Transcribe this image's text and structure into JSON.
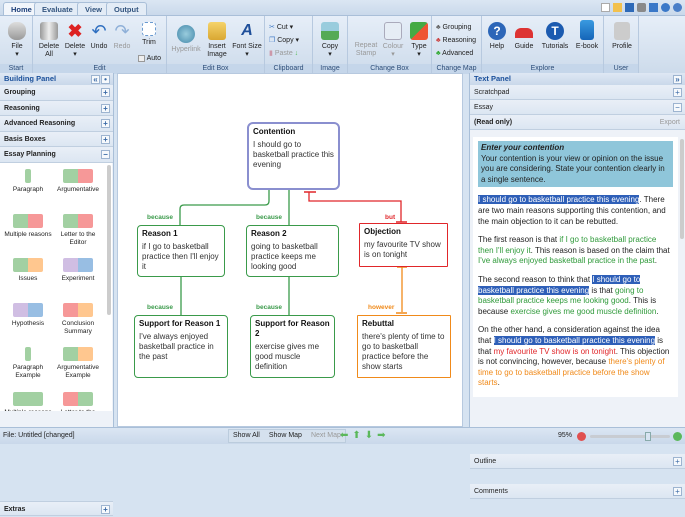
{
  "tabs": [
    "Home",
    "Evaluate",
    "View",
    "Output"
  ],
  "ribbon": {
    "start": {
      "label": "Start",
      "file": "File"
    },
    "edit": {
      "label": "Edit",
      "delete_all": "Delete All",
      "delete": "Delete",
      "undo": "Undo",
      "redo": "Redo",
      "trim": "Trim",
      "auto": "Auto"
    },
    "edit_box": {
      "label": "Edit Box",
      "hyperlink": "Hyperlink",
      "insert_image": "Insert Image",
      "font_size": "Font Size"
    },
    "clipboard": {
      "label": "Clipboard",
      "cut": "Cut",
      "copy": "Copy",
      "paste": "Paste"
    },
    "image": {
      "label": "Image",
      "copy": "Copy"
    },
    "change_box": {
      "label": "Change Box",
      "repeat_stamp": "Repeat Stamp",
      "colour": "Colour",
      "type": "Type"
    },
    "change_map": {
      "label": "Change Map",
      "grouping": "Grouping",
      "reasoning": "Reasoning",
      "advanced": "Advanced"
    },
    "explore": {
      "label": "Explore",
      "help": "Help",
      "guide": "Guide",
      "tutorials": "Tutorials",
      "ebook": "E-book"
    },
    "user": {
      "label": "User",
      "profile": "Profile"
    }
  },
  "building_panel": {
    "title": "Building Panel",
    "sections": [
      "Grouping",
      "Reasoning",
      "Advanced Reasoning",
      "Basis Boxes",
      "Essay Planning"
    ],
    "extras": "Extras",
    "templates": [
      "Paragraph",
      "Argumentative",
      "Multiple reasons",
      "Letter to the Editor",
      "Issues",
      "Experiment",
      "Hypothesis",
      "Conclusion Summary",
      "Paragraph Example",
      "Argumentative Example",
      "Multiple reasons",
      "Letter to the Editor"
    ]
  },
  "map": {
    "contention": {
      "title": "Contention",
      "text": "I should go to basketball practice this evening"
    },
    "reason1": {
      "title": "Reason 1",
      "text": "if I go to basketball practice then I'll enjoy it"
    },
    "reason2": {
      "title": "Reason 2",
      "text": "going to basketball practice keeps me looking good"
    },
    "objection": {
      "title": "Objection",
      "text": "my favourite TV show is on tonight"
    },
    "support1": {
      "title": "Support for Reason 1",
      "text": "I've always enjoyed basketball practice in the past"
    },
    "support2": {
      "title": "Support for Reason 2",
      "text": "exercise gives me good muscle definition"
    },
    "rebuttal": {
      "title": "Rebuttal",
      "text": "there's plenty of time to go to basketball practice before the show starts"
    },
    "labels": {
      "because": "because",
      "but": "but",
      "however": "however"
    },
    "colors": {
      "contention": "#8a8fcf",
      "reason": "#3a9a4a",
      "objection": "#e0262a",
      "rebuttal": "#f08a1a"
    }
  },
  "text_panel": {
    "title": "Text Panel",
    "scratchpad": "Scratchpad",
    "essay": "Essay",
    "read_only": "(Read only)",
    "export": "Export",
    "outline": "Outline",
    "comments": "Comments",
    "essay_text": {
      "prompt_title": "Enter your contention",
      "prompt_body": "Your contention is your view or opinion on the issue you are considering. State your contention clearly in a single sentence.",
      "contention": "I should go to basketball practice this evening",
      "p1_rest": ". There are two main reasons supporting this contention, and the main objection to it can be rebutted.",
      "p2_a": "The first reason is that ",
      "p2_b": "if I go to basketball practice then I'll enjoy it",
      "p2_c": ". This reason is based on the claim that ",
      "p2_d": "I've always enjoyed basketball practice in the past",
      "p2_e": ".",
      "p3_a": "The second reason to think that ",
      "p3_c": " is that ",
      "p3_d": "going to basketball practice keeps me looking good",
      "p3_e": ". This is because ",
      "p3_f": "exercise gives me good muscle definition",
      "p3_g": ".",
      "p4_a": "On the other hand, a consideration against the idea that ",
      "p4_c": " is that ",
      "p4_d": "my favourite TV show is on tonight",
      "p4_e": ". This objection is not convincing, however, because ",
      "p4_f": "there's plenty of time to go to basketball practice before the show starts",
      "p4_g": "."
    }
  },
  "status": {
    "file": "File: Untitled [changed]",
    "show_all": "Show All",
    "show_map": "Show Map",
    "next_map": "Next Map",
    "zoom": "95%",
    "zoom_level": 95
  }
}
